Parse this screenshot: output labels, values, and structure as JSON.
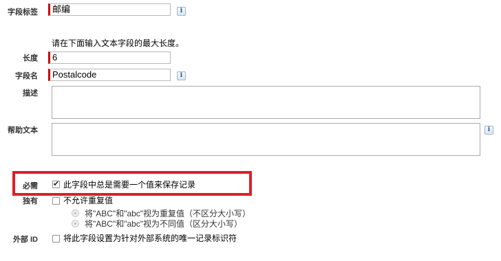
{
  "field_label": {
    "label": "字段标签",
    "value": "邮编"
  },
  "instruction": "请在下面输入文本字段的最大长度。",
  "length": {
    "label": "长度",
    "value": "6"
  },
  "field_name": {
    "label": "字段名",
    "value": "Postalcode"
  },
  "description": {
    "label": "描述",
    "value": ""
  },
  "help_text": {
    "label": "帮助文本",
    "value": ""
  },
  "info_icon": {
    "glyph": "i"
  },
  "required": {
    "label": "必需",
    "checkbox_label": "此字段中总是需要一个值来保存记录",
    "checked": true
  },
  "unique": {
    "label": "独有",
    "checkbox_label": "不允许重复值",
    "checked": false,
    "options": [
      "将\"ABC\"和\"abc\"视为重复值（不区分大小写）",
      "将\"ABC\"和\"abc\"视为不同值（区分大小写）"
    ]
  },
  "external_id": {
    "label": "外部 ID",
    "checkbox_label": "将此字段设置为针对外部系统的唯一记录标识符",
    "checked": false
  },
  "colors": {
    "required_bar": "#cc0000",
    "highlight": "#e01d2a",
    "info_icon": "#1b5a95"
  }
}
